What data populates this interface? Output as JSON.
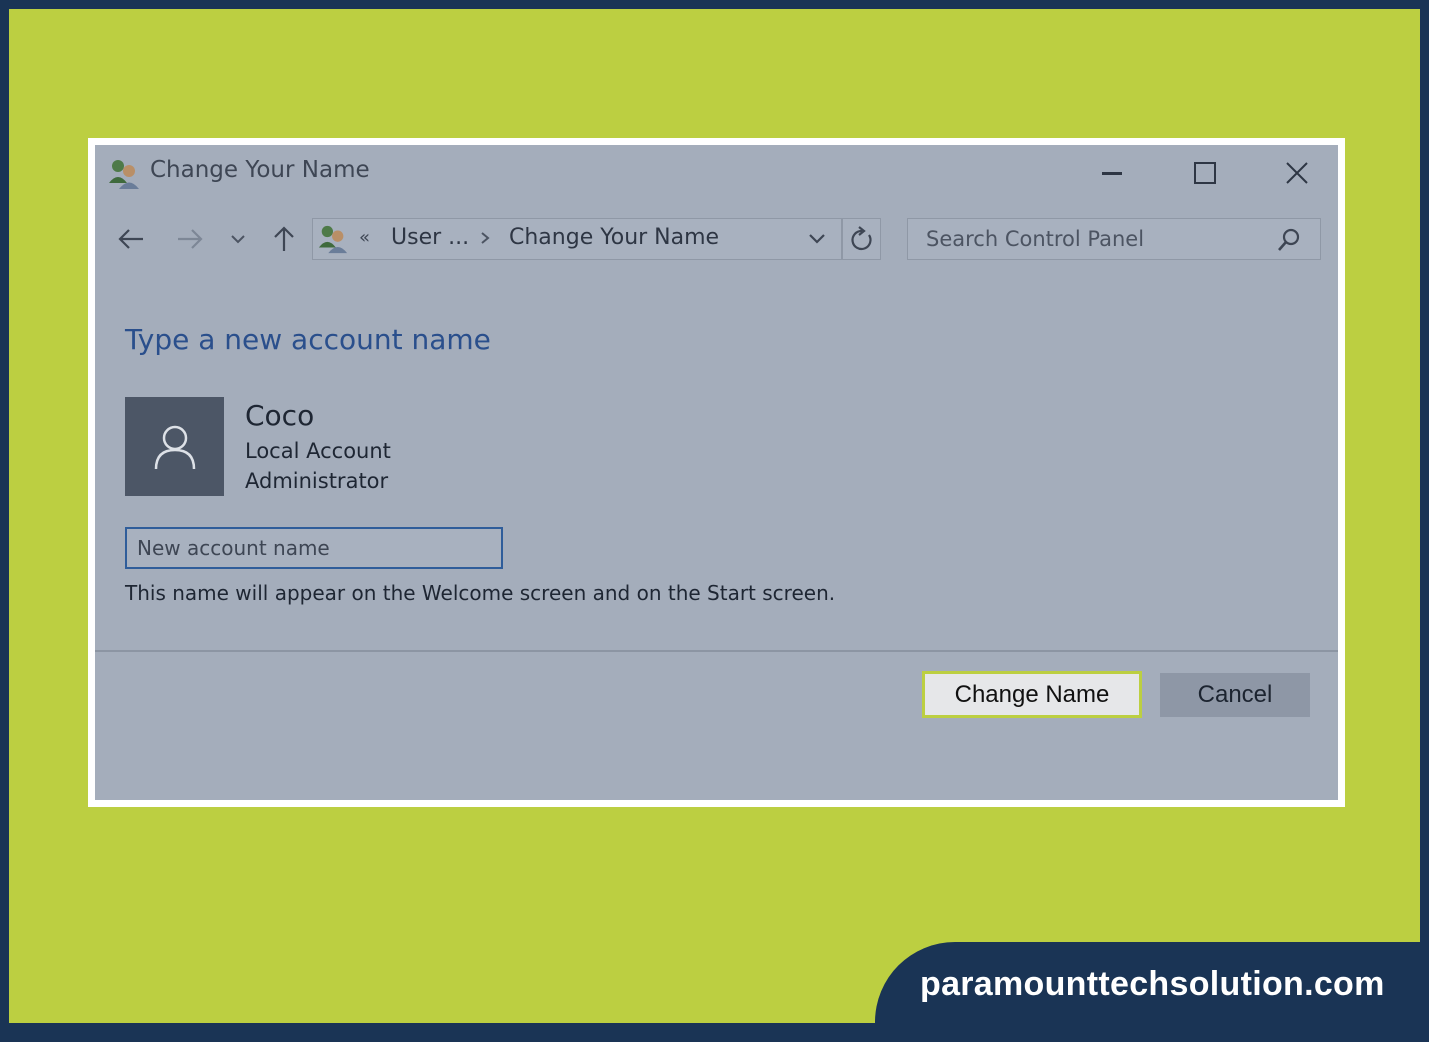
{
  "window": {
    "title": "Change Your Name",
    "controls": {
      "minimize": "minimize-icon",
      "maximize": "maximize-icon",
      "close": "close-icon"
    }
  },
  "navigation": {
    "back": "arrow-left-icon",
    "forward": "arrow-right-icon",
    "recent": "chevron-down-icon",
    "up": "arrow-up-icon",
    "breadcrumb": {
      "overflow": "«",
      "segment_1": "User ...",
      "separator": "›",
      "segment_2": "Change Your Name"
    },
    "search_placeholder": "Search Control Panel"
  },
  "content": {
    "heading": "Type a new account name",
    "user": {
      "name": "Coco",
      "account_type": "Local Account",
      "role": "Administrator"
    },
    "input_placeholder": "New account name",
    "hint": "This name will appear on the Welcome screen and on the Start screen."
  },
  "buttons": {
    "change_name": "Change Name",
    "cancel": "Cancel"
  },
  "branding": {
    "site": "paramounttechsolution.com"
  },
  "colors": {
    "outer_border": "#1a3455",
    "background": "#bccf41",
    "window_bg": "#a4adbb",
    "heading": "#2a4f8c",
    "input_border": "#2f5d9a",
    "primary_button_border": "#bccf41"
  }
}
